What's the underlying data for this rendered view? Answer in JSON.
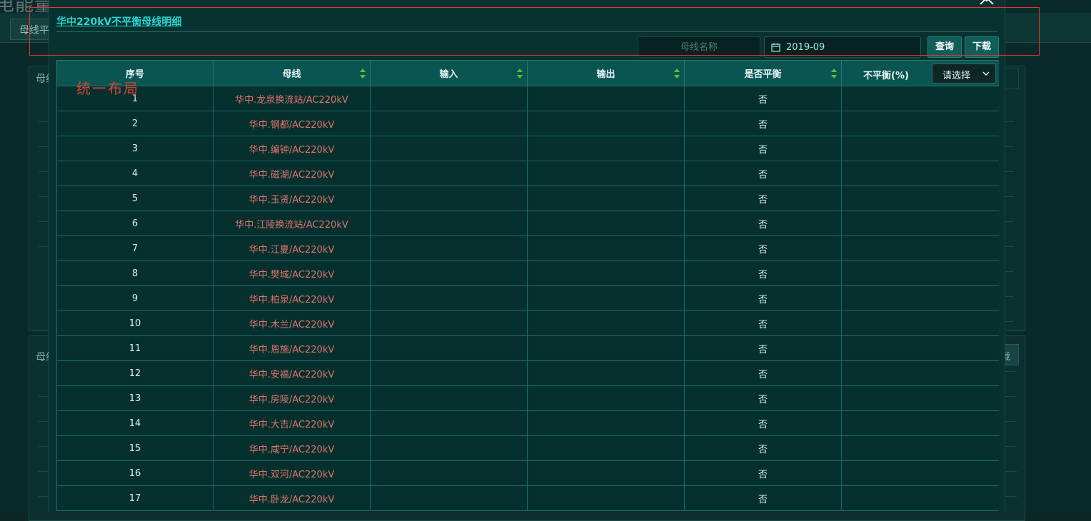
{
  "background": {
    "title": "电能量数据分析与运维系统",
    "tab_label": "母线平衡",
    "panel_label_top": "母线",
    "panel_label_bottom": "母线",
    "side_button_label": "载"
  },
  "modal": {
    "title": "华中220kV不平衡母线明细",
    "search": {
      "placeholder": "母线名称",
      "value": ""
    },
    "date": {
      "value": "2019-09"
    },
    "query_label": "查询",
    "download_label": "下载"
  },
  "table": {
    "columns": {
      "index": "序号",
      "bus": "母线",
      "input": "输入",
      "output": "输出",
      "balanced": "是否平衡",
      "unbalance": "不平衡(%)"
    },
    "filter_placeholder": "请选择",
    "rows": [
      {
        "index": "1",
        "bus": "华中.龙泉换流站/AC220kV",
        "input": "",
        "output": "",
        "balanced": "否",
        "unbalance": ""
      },
      {
        "index": "2",
        "bus": "华中.钢都/AC220kV",
        "input": "",
        "output": "",
        "balanced": "否",
        "unbalance": ""
      },
      {
        "index": "3",
        "bus": "华中.编钟/AC220kV",
        "input": "",
        "output": "",
        "balanced": "否",
        "unbalance": ""
      },
      {
        "index": "4",
        "bus": "华中.磁湖/AC220kV",
        "input": "",
        "output": "",
        "balanced": "否",
        "unbalance": ""
      },
      {
        "index": "5",
        "bus": "华中.玉贤/AC220kV",
        "input": "",
        "output": "",
        "balanced": "否",
        "unbalance": ""
      },
      {
        "index": "6",
        "bus": "华中.江陵换流站/AC220kV",
        "input": "",
        "output": "",
        "balanced": "否",
        "unbalance": ""
      },
      {
        "index": "7",
        "bus": "华中.江夏/AC220kV",
        "input": "",
        "output": "",
        "balanced": "否",
        "unbalance": ""
      },
      {
        "index": "8",
        "bus": "华中.樊城/AC220kV",
        "input": "",
        "output": "",
        "balanced": "否",
        "unbalance": ""
      },
      {
        "index": "9",
        "bus": "华中.柏泉/AC220kV",
        "input": "",
        "output": "",
        "balanced": "否",
        "unbalance": ""
      },
      {
        "index": "10",
        "bus": "华中.木兰/AC220kV",
        "input": "",
        "output": "",
        "balanced": "否",
        "unbalance": ""
      },
      {
        "index": "11",
        "bus": "华中.恩施/AC220kV",
        "input": "",
        "output": "",
        "balanced": "否",
        "unbalance": ""
      },
      {
        "index": "12",
        "bus": "华中.安福/AC220kV",
        "input": "",
        "output": "",
        "balanced": "否",
        "unbalance": ""
      },
      {
        "index": "13",
        "bus": "华中.房陵/AC220kV",
        "input": "",
        "output": "",
        "balanced": "否",
        "unbalance": ""
      },
      {
        "index": "14",
        "bus": "华中.大吉/AC220kV",
        "input": "",
        "output": "",
        "balanced": "否",
        "unbalance": ""
      },
      {
        "index": "15",
        "bus": "华中.咸宁/AC220kV",
        "input": "",
        "output": "",
        "balanced": "否",
        "unbalance": ""
      },
      {
        "index": "16",
        "bus": "华中.双河/AC220kV",
        "input": "",
        "output": "",
        "balanced": "否",
        "unbalance": ""
      },
      {
        "index": "17",
        "bus": "华中.卧龙/AC220kV",
        "input": "",
        "output": "",
        "balanced": "否",
        "unbalance": ""
      }
    ]
  },
  "annotation": {
    "text": "统一布局"
  },
  "colors": {
    "accent": "#27d6cf",
    "bus_text": "#e2736b",
    "header_bg": "#0a5552",
    "button_bg": "#0f5e5a",
    "annotation": "#e0362c"
  }
}
